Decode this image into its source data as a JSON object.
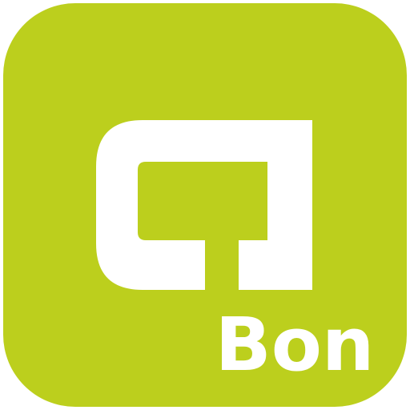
{
  "icon": {
    "brand_text": "Bon",
    "logo_name": "bon-app-logo",
    "colors": {
      "background": "#bccf1d",
      "foreground": "#ffffff",
      "page": "#ffffff"
    }
  }
}
